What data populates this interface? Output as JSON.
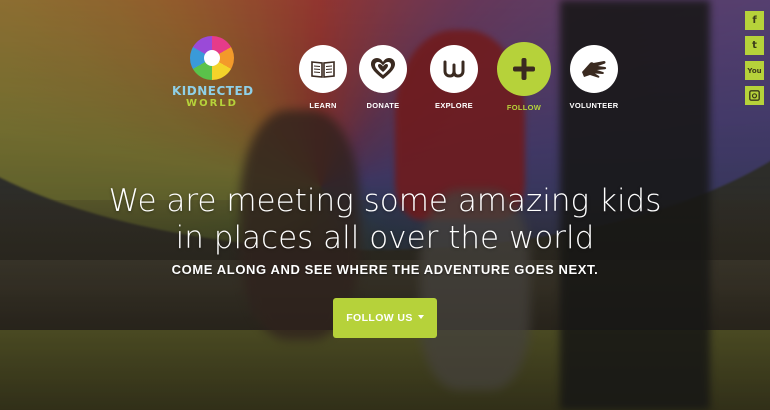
{
  "logo": {
    "line1": "KIDNECTED",
    "line2": "WORLD"
  },
  "nav": {
    "items": [
      {
        "label": "LEARN",
        "icon": "book-icon"
      },
      {
        "label": "DONATE",
        "icon": "heart-icon"
      },
      {
        "label": "EXPLORE",
        "icon": "w-icon"
      },
      {
        "label": "FOLLOW",
        "icon": "plus-icon",
        "active": true
      },
      {
        "label": "VOLUNTEER",
        "icon": "hand-icon"
      }
    ]
  },
  "social": [
    {
      "label": "f",
      "icon": "facebook-icon"
    },
    {
      "label": "t",
      "icon": "twitter-icon"
    },
    {
      "label": "You",
      "icon": "youtube-icon"
    },
    {
      "label": "",
      "icon": "instagram-icon"
    }
  ],
  "hero": {
    "headline_line1": "We are meeting some amazing kids",
    "headline_line2": "in places all over the world",
    "subhead": "COME ALONG AND SEE WHERE THE ADVENTURE GOES NEXT.",
    "button_label": "FOLLOW US"
  },
  "colors": {
    "accent": "#b6d23a",
    "text": "#ffffff"
  }
}
